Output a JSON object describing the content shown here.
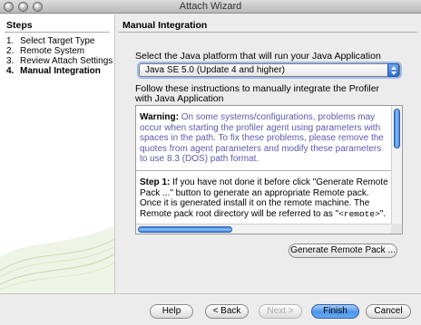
{
  "window": {
    "title": "Attach Wizard"
  },
  "steps": {
    "title": "Steps",
    "items": [
      {
        "num": "1.",
        "label": "Select Target Type"
      },
      {
        "num": "2.",
        "label": "Remote System"
      },
      {
        "num": "3.",
        "label": "Review Attach Settings"
      },
      {
        "num": "4.",
        "label": "Manual Integration"
      }
    ]
  },
  "content": {
    "title": "Manual Integration",
    "platform_label": "Select the Java platform that will run your Java Application",
    "platform_selected": "Java SE 5.0 (Update 4 and higher)",
    "instructions_label": "Follow these instructions to manually integrate the Profiler with Java Application",
    "warning_label": "Warning:",
    "warning_text": "On some systems/configurations, problems may occur when starting the profiler agent using parameters with spaces in the path. To fix these problems, please remove the quotes from agent parameters and modify these parameters to use 8.3 (DOS) path format.",
    "step1_label": "Step 1:",
    "step1_text": "If you have not done it before click \"Generate Remote Pack ...\" button to generate an appropriate Remote pack. Once it is generated install it on the remote machine. The Remote pack root directory will be referred to as \"",
    "step1_code": "<remote>",
    "step1_end": "\".",
    "generate_button": "Generate Remote Pack ..."
  },
  "buttons": {
    "help": "Help",
    "back": "< Back",
    "next": "Next >",
    "finish": "Finish",
    "cancel": "Cancel"
  }
}
